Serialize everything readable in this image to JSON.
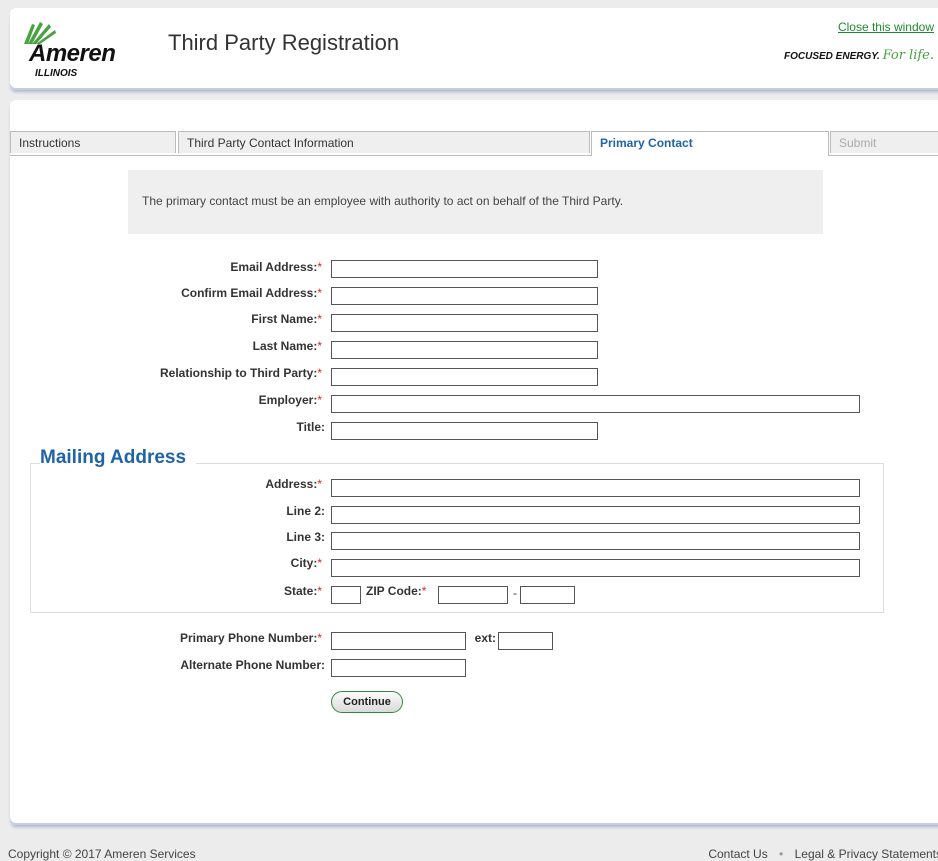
{
  "header": {
    "logo_word": "Ameren",
    "logo_sub": "ILLINOIS",
    "title": "Third Party Registration",
    "close_link": "Close this window",
    "tagline_text": "FOCUSED ENERGY.",
    "tagline_script": "For life."
  },
  "tabs": [
    {
      "label": "Instructions"
    },
    {
      "label": "Third Party Contact Information"
    },
    {
      "label": "Primary Contact"
    },
    {
      "label": "Submit"
    }
  ],
  "notice": "The primary contact must be an employee with authority to act on behalf of the Third Party.",
  "required_mark": "*",
  "contact_fields": {
    "email": "Email Address:",
    "confirm_email": "Confirm Email Address:",
    "first_name": "First Name:",
    "last_name": "Last Name:",
    "relationship": "Relationship to Third Party:",
    "employer": "Employer:",
    "title": "Title:"
  },
  "mailing": {
    "heading": "Mailing Address",
    "address": "Address:",
    "line2": "Line 2:",
    "line3": "Line 3:",
    "city": "City:",
    "state": "State:",
    "zip": "ZIP Code:",
    "zip_sep": "-"
  },
  "phone": {
    "primary": "Primary Phone Number:",
    "ext": "ext:",
    "alternate": "Alternate Phone Number:"
  },
  "continue_label": "Continue",
  "footer": {
    "copyright": "Copyright © 2017 Ameren Services",
    "contact": "Contact Us",
    "sep": "•",
    "legal": "Legal & Privacy Statements"
  },
  "colors": {
    "accent_blue": "#1f63a8",
    "brand_green": "#47a23f",
    "required_red": "#dd2222"
  }
}
